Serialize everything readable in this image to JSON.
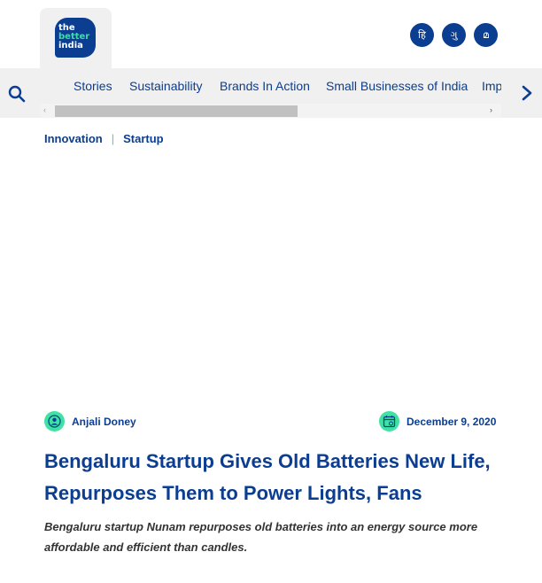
{
  "brand": {
    "logo_lines": [
      "the",
      "better",
      "india"
    ]
  },
  "languages": [
    {
      "label": "हि"
    },
    {
      "label": "ગુ"
    },
    {
      "label": "മ"
    }
  ],
  "nav": {
    "items": [
      {
        "label": "Stories"
      },
      {
        "label": "Sustainability"
      },
      {
        "label": "Brands In Action"
      },
      {
        "label": "Small Businesses of India"
      },
      {
        "label": "Impact"
      }
    ],
    "scroll_left_glyph": "‹",
    "scroll_right_glyph": "›"
  },
  "breadcrumb": {
    "items": [
      "Innovation",
      "Startup"
    ],
    "separator": "|"
  },
  "article": {
    "author": "Anjali Doney",
    "date": "December 9, 2020",
    "headline": "Bengaluru Startup Gives Old Batteries New Life, Repurposes Them to Power Lights, Fans",
    "subheadline": "Bengaluru startup Nunam repurposes old batteries into an energy source more affordable and efficient than candles."
  },
  "colors": {
    "brand_blue": "#0b3d91",
    "accent_green": "#39e0a0",
    "nav_bg": "#f0f0f0"
  },
  "icons": [
    "search-icon",
    "chevron-right-icon",
    "user-icon",
    "calendar-icon"
  ]
}
